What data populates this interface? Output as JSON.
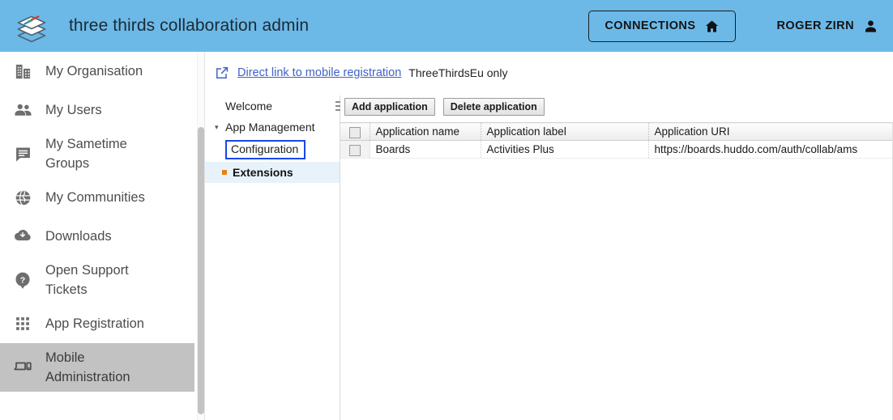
{
  "header": {
    "app_title": "three thirds collaboration admin",
    "logo_icon": "stacked-layers-logo",
    "connections_label": "CONNECTIONS",
    "connections_icon": "home-icon",
    "user_name": "ROGER ZIRN",
    "user_icon": "person-icon",
    "background_color": "#6cb9e8"
  },
  "sidebar": {
    "items": [
      {
        "label": "My Organisation",
        "icon": "building-icon",
        "selected": false
      },
      {
        "label": "My Users",
        "icon": "people-icon",
        "selected": false
      },
      {
        "label": "My Sametime Groups",
        "icon": "chat-bubble-icon",
        "selected": false
      },
      {
        "label": "My Communities",
        "icon": "globe-icon",
        "selected": false
      },
      {
        "label": "Downloads",
        "icon": "cloud-download-icon",
        "selected": false
      },
      {
        "label": "Open Support Tickets",
        "icon": "help-question-icon",
        "selected": false
      },
      {
        "label": "App Registration",
        "icon": "apps-grid-icon",
        "selected": false
      },
      {
        "label": "Mobile Administration",
        "icon": "devices-icon",
        "selected": true
      }
    ],
    "selected_background": "#c2c2c2"
  },
  "main": {
    "direct_link": {
      "icon": "external-link-icon",
      "label": "Direct link to mobile registration",
      "note": "ThreeThirdsEu only",
      "link_color": "#4062c7"
    },
    "tree": {
      "splitter_icon": "splitter-grip-icon",
      "nodes": [
        {
          "label": "Welcome",
          "level": 0,
          "expander": "",
          "state": "normal"
        },
        {
          "label": "App Management",
          "level": 0,
          "expander": "▾",
          "state": "normal"
        },
        {
          "label": "Configuration",
          "level": 1,
          "expander": "",
          "state": "focused"
        },
        {
          "label": "Extensions",
          "level": 1,
          "expander": "",
          "state": "selected"
        }
      ],
      "focus_outline_color": "#1a47e8",
      "selected_background": "#e7f2fa",
      "bullet_color": "#e8820c"
    },
    "toolbar": {
      "add_application_label": "Add application",
      "delete_application_label": "Delete application"
    },
    "table": {
      "select_all_checkbox": "select-all-checkbox",
      "columns": [
        "Application name",
        "Application label",
        "Application URI"
      ],
      "rows": [
        {
          "checked": false,
          "application_name": "Boards",
          "application_label": "Activities Plus",
          "application_uri": "https://boards.huddo.com/auth/collab/ams"
        }
      ]
    }
  }
}
